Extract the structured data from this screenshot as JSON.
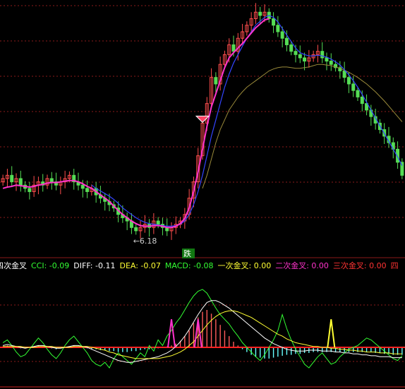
{
  "colors": {
    "background": "#000000",
    "grid": "#8b1a1a",
    "up": "#ff4d4d",
    "down": "#55dd55",
    "price_axis_mark": "#ff3030",
    "ma_short_pink": "#ff33cc",
    "ma_blue": "#3344ff",
    "ma_long_olive": "#9a8a3a",
    "macd_pos": "#ff5a5a",
    "macd_neg": "#66ffff",
    "cci": "#33ff33",
    "diff": "#ffffff",
    "dea": "#ffff33",
    "signal_magenta": "#ff33cc",
    "signal_yellow": "#ffff33"
  },
  "chart_data": [
    {
      "type": "candlestick",
      "panel": "main",
      "grid": true,
      "annotation_low_label": "←6.18",
      "marker_label": "跌",
      "marker_icon": "diamond-down-marker-icon",
      "closes": [
        7.05,
        7.1,
        7.0,
        7.05,
        6.95,
        6.9,
        6.85,
        6.95,
        7.0,
        6.95,
        7.05,
        7.0,
        6.95,
        7.0,
        7.05,
        7.1,
        7.0,
        6.95,
        6.9,
        6.85,
        6.9,
        6.8,
        6.75,
        6.7,
        6.65,
        6.6,
        6.5,
        6.45,
        6.4,
        6.3,
        6.25,
        6.3,
        6.35,
        6.3,
        6.4,
        6.35,
        6.3,
        6.25,
        6.3,
        6.35,
        6.4,
        6.5,
        6.75,
        7.0,
        7.4,
        7.9,
        8.2,
        8.6,
        8.5,
        8.8,
        8.95,
        9.1,
        9.0,
        9.2,
        9.3,
        9.4,
        9.5,
        9.6,
        9.55,
        9.6,
        9.5,
        9.4,
        9.3,
        9.2,
        9.1,
        9.0,
        8.95,
        8.9,
        8.85,
        8.9,
        8.95,
        9.0,
        8.9,
        8.85,
        8.8,
        8.75,
        8.7,
        8.6,
        8.5,
        8.4,
        8.3,
        8.2,
        8.1,
        8.0,
        7.9,
        7.8,
        7.7,
        7.6,
        7.5,
        7.3,
        7.1
      ],
      "ma_short_pink": [
        6.9,
        6.92,
        6.93,
        6.95,
        6.94,
        6.93,
        6.92,
        6.93,
        6.95,
        6.96,
        6.98,
        6.99,
        6.99,
        7.0,
        7.01,
        7.02,
        7.02,
        7.0,
        6.97,
        6.93,
        6.9,
        6.85,
        6.8,
        6.75,
        6.7,
        6.63,
        6.56,
        6.5,
        6.45,
        6.4,
        6.36,
        6.33,
        6.32,
        6.32,
        6.33,
        6.33,
        6.32,
        6.3,
        6.3,
        6.32,
        6.36,
        6.44,
        6.6,
        6.85,
        7.15,
        7.5,
        7.85,
        8.15,
        8.35,
        8.55,
        8.75,
        8.9,
        8.98,
        9.05,
        9.12,
        9.2,
        9.28,
        9.36,
        9.42,
        9.48,
        9.5
      ],
      "ma_blue": [
        null,
        null,
        null,
        null,
        null,
        null,
        null,
        null,
        null,
        null,
        null,
        null,
        null,
        null,
        null,
        null,
        null,
        null,
        null,
        null,
        6.95,
        6.9,
        6.86,
        6.82,
        6.78,
        6.73,
        6.67,
        6.6,
        6.55,
        6.5,
        6.45,
        6.41,
        6.38,
        6.36,
        6.35,
        6.34,
        6.33,
        6.32,
        6.32,
        6.33,
        6.35,
        6.4,
        6.5,
        6.65,
        6.85,
        7.1,
        7.4,
        7.7,
        7.95,
        8.2,
        8.45,
        8.65,
        8.82,
        8.95,
        9.08,
        9.2,
        9.3,
        9.4,
        9.46,
        9.52,
        9.55,
        9.52,
        9.45,
        9.35,
        9.25,
        9.15,
        9.05,
        8.98,
        8.95,
        8.93,
        8.93,
        8.94,
        8.93,
        8.91,
        8.88,
        8.84,
        8.79,
        8.72,
        8.64,
        8.55,
        8.45,
        8.34,
        8.22,
        8.1,
        7.98,
        7.86,
        7.74,
        7.62,
        7.5,
        7.38,
        7.25
      ],
      "ma_long_olive": [
        null,
        null,
        null,
        null,
        null,
        null,
        null,
        null,
        null,
        null,
        null,
        null,
        null,
        null,
        null,
        null,
        null,
        null,
        null,
        null,
        null,
        null,
        null,
        null,
        null,
        null,
        null,
        null,
        null,
        null,
        null,
        null,
        null,
        null,
        null,
        null,
        null,
        null,
        null,
        null,
        null,
        null,
        null,
        null,
        null,
        6.9,
        7.1,
        7.35,
        7.6,
        7.8,
        7.95,
        8.1,
        8.2,
        8.3,
        8.38,
        8.45,
        8.5,
        8.55,
        8.6,
        8.65,
        8.7,
        8.73,
        8.75,
        8.76,
        8.76,
        8.75,
        8.74,
        8.74,
        8.75,
        8.76,
        8.78,
        8.8,
        8.8,
        8.79,
        8.78,
        8.76,
        8.74,
        8.71,
        8.68,
        8.64,
        8.6,
        8.55,
        8.5,
        8.44,
        8.38,
        8.31,
        8.24,
        8.16,
        8.08,
        8.0,
        7.92
      ],
      "ylim": [
        6.0,
        9.7
      ]
    },
    {
      "type": "indicator",
      "panel": "sub",
      "grid": true,
      "legend": [
        {
          "key": "四次金叉",
          "text": "四次金叉",
          "color": "#ffffff"
        },
        {
          "key": "CCI",
          "text": "CCI: -0.09",
          "color": "#33ff33"
        },
        {
          "key": "DIFF",
          "text": "DIFF: -0.11",
          "color": "#ffffff"
        },
        {
          "key": "DEA",
          "text": "DEA: -0.07",
          "color": "#ffff33"
        },
        {
          "key": "MACD",
          "text": "MACD: -0.08",
          "color": "#33ff33"
        },
        {
          "key": "一次金叉",
          "text": "一次金叉: 0.00",
          "color": "#ffff33"
        },
        {
          "key": "二次金叉",
          "text": "二次金叉: 0.00",
          "color": "#ff33cc"
        },
        {
          "key": "三次金叉",
          "text": "三次金叉: 0.00",
          "color": "#ff3333"
        },
        {
          "key": "四",
          "text": "四",
          "color": "#ff3333"
        }
      ],
      "macd_hist": [
        0.01,
        0.02,
        0.01,
        0.0,
        -0.01,
        -0.01,
        0.0,
        0.01,
        0.02,
        0.01,
        0.0,
        -0.01,
        -0.02,
        -0.01,
        0.0,
        0.01,
        0.02,
        0.01,
        0.0,
        -0.01,
        -0.02,
        -0.02,
        -0.03,
        -0.03,
        -0.04,
        -0.04,
        -0.05,
        -0.05,
        -0.05,
        -0.04,
        -0.04,
        -0.03,
        -0.02,
        -0.02,
        -0.01,
        -0.01,
        0.0,
        0.01,
        0.02,
        0.04,
        0.07,
        0.12,
        0.18,
        0.26,
        0.32,
        0.38,
        0.4,
        0.36,
        0.3,
        0.24,
        0.18,
        0.12,
        0.06,
        0.02,
        -0.02,
        -0.05,
        -0.08,
        -0.1,
        -0.11,
        -0.12,
        -0.12,
        -0.11,
        -0.1,
        -0.09,
        -0.08,
        -0.08,
        -0.07,
        -0.07,
        -0.06,
        -0.06,
        -0.05,
        -0.05,
        -0.05,
        -0.05,
        -0.05,
        -0.05,
        -0.05,
        -0.05,
        -0.05,
        -0.05,
        -0.05,
        -0.05,
        -0.05,
        -0.05,
        -0.06,
        -0.06,
        -0.07,
        -0.07,
        -0.08,
        -0.08,
        -0.08
      ],
      "diff": [
        0.02,
        0.03,
        0.02,
        0.01,
        0.0,
        -0.01,
        0.0,
        0.01,
        0.02,
        0.02,
        0.01,
        0.0,
        -0.01,
        -0.01,
        0.0,
        0.01,
        0.02,
        0.02,
        0.01,
        0.0,
        -0.02,
        -0.04,
        -0.06,
        -0.08,
        -0.1,
        -0.12,
        -0.14,
        -0.15,
        -0.16,
        -0.16,
        -0.15,
        -0.14,
        -0.13,
        -0.12,
        -0.11,
        -0.1,
        -0.08,
        -0.06,
        -0.03,
        0.01,
        0.06,
        0.12,
        0.19,
        0.27,
        0.35,
        0.42,
        0.48,
        0.5,
        0.5,
        0.48,
        0.45,
        0.42,
        0.38,
        0.34,
        0.3,
        0.26,
        0.22,
        0.18,
        0.14,
        0.1,
        0.07,
        0.04,
        0.02,
        0.0,
        -0.02,
        -0.03,
        -0.04,
        -0.04,
        -0.04,
        -0.03,
        -0.03,
        -0.03,
        -0.04,
        -0.04,
        -0.04,
        -0.05,
        -0.05,
        -0.06,
        -0.06,
        -0.07,
        -0.07,
        -0.08,
        -0.08,
        -0.09,
        -0.09,
        -0.1,
        -0.1,
        -0.1,
        -0.11,
        -0.11,
        -0.11
      ],
      "dea": [
        0.01,
        0.01,
        0.01,
        0.01,
        0.01,
        0.0,
        0.0,
        0.0,
        0.01,
        0.01,
        0.01,
        0.01,
        0.0,
        0.0,
        0.0,
        0.0,
        0.01,
        0.01,
        0.01,
        0.01,
        0.0,
        -0.01,
        -0.02,
        -0.03,
        -0.05,
        -0.06,
        -0.08,
        -0.09,
        -0.1,
        -0.11,
        -0.12,
        -0.12,
        -0.12,
        -0.12,
        -0.12,
        -0.12,
        -0.11,
        -0.1,
        -0.09,
        -0.07,
        -0.05,
        -0.02,
        0.02,
        0.06,
        0.12,
        0.18,
        0.24,
        0.29,
        0.33,
        0.36,
        0.38,
        0.39,
        0.39,
        0.38,
        0.36,
        0.34,
        0.32,
        0.29,
        0.26,
        0.23,
        0.2,
        0.17,
        0.14,
        0.12,
        0.09,
        0.07,
        0.05,
        0.04,
        0.03,
        0.02,
        0.01,
        0.01,
        0.0,
        0.0,
        -0.01,
        -0.01,
        -0.02,
        -0.02,
        -0.03,
        -0.03,
        -0.04,
        -0.04,
        -0.05,
        -0.05,
        -0.05,
        -0.06,
        -0.06,
        -0.06,
        -0.07,
        -0.07,
        -0.07
      ],
      "cci": [
        0.05,
        0.08,
        0.02,
        -0.05,
        -0.1,
        -0.08,
        -0.02,
        0.04,
        0.1,
        0.05,
        -0.02,
        -0.08,
        -0.12,
        -0.06,
        0.02,
        0.08,
        0.12,
        0.06,
        0.0,
        -0.06,
        -0.14,
        -0.18,
        -0.2,
        -0.16,
        -0.22,
        -0.12,
        -0.06,
        -0.1,
        -0.14,
        -0.18,
        -0.12,
        -0.06,
        -0.1,
        0.02,
        -0.04,
        0.08,
        0.02,
        0.12,
        0.18,
        0.26,
        0.32,
        0.4,
        0.48,
        0.55,
        0.6,
        0.62,
        0.58,
        0.5,
        0.42,
        0.35,
        0.3,
        0.25,
        0.18,
        0.12,
        0.05,
        0.0,
        -0.05,
        -0.1,
        -0.14,
        -0.08,
        0.0,
        0.08,
        0.18,
        0.35,
        0.2,
        0.08,
        -0.02,
        -0.1,
        -0.18,
        -0.22,
        -0.16,
        -0.1,
        -0.06,
        -0.12,
        -0.18,
        -0.16,
        -0.1,
        -0.06,
        -0.02,
        0.0,
        0.02,
        0.06,
        0.1,
        0.08,
        0.04,
        0.0,
        -0.04,
        -0.08,
        -0.12,
        -0.14,
        -0.09
      ],
      "signals": [
        {
          "index": 38,
          "color": "#ff33cc",
          "value": 0.3
        },
        {
          "index": 44,
          "color": "#ff33cc",
          "value": 0.3
        },
        {
          "index": 74,
          "color": "#ffff33",
          "value": 0.3
        }
      ],
      "ylim": [
        -0.4,
        0.8
      ]
    }
  ]
}
